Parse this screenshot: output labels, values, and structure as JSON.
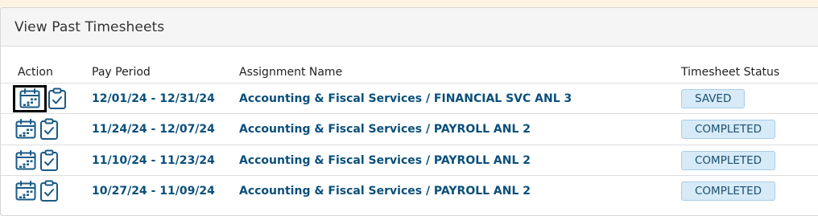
{
  "panel": {
    "title": "View Past Timesheets"
  },
  "table": {
    "headers": {
      "action": "Action",
      "pay_period": "Pay Period",
      "assignment": "Assignment Name",
      "status": "Timesheet Status"
    },
    "rows": [
      {
        "pay_period": "12/01/24 - 12/31/24",
        "assignment": "Accounting & Fiscal Services / FINANCIAL SVC ANL 3",
        "status": "SAVED",
        "selected": true
      },
      {
        "pay_period": "11/24/24 - 12/07/24",
        "assignment": "Accounting & Fiscal Services / PAYROLL ANL 2",
        "status": "COMPLETED",
        "selected": false
      },
      {
        "pay_period": "11/10/24 - 11/23/24",
        "assignment": "Accounting & Fiscal Services / PAYROLL ANL 2",
        "status": "COMPLETED",
        "selected": false
      },
      {
        "pay_period": "10/27/24 - 11/09/24",
        "assignment": "Accounting & Fiscal Services / PAYROLL ANL 2",
        "status": "COMPLETED",
        "selected": false
      }
    ],
    "icons": {
      "view": "calendar-icon",
      "submit": "clipboard-check-icon"
    }
  },
  "colors": {
    "link": "#0a4f7a",
    "icon": "#1a5a86",
    "badge_bg": "#d6eaf8",
    "badge_border": "#a9cde8"
  }
}
